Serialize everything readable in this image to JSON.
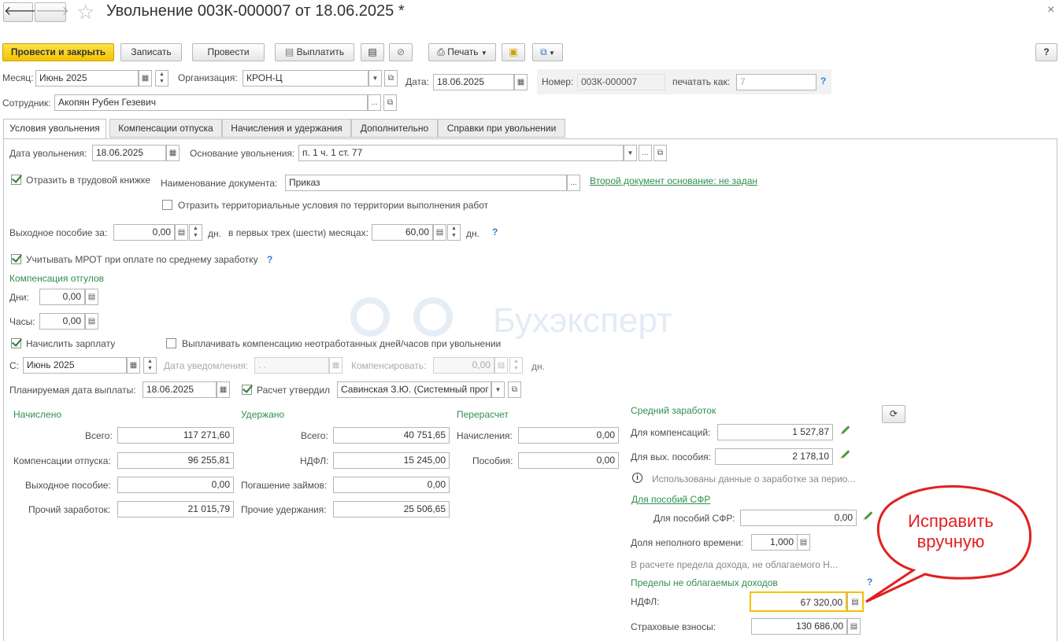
{
  "window": {
    "title": "Увольнение 003К-000007 от 18.06.2025 *",
    "close": "×"
  },
  "toolbar": {
    "post_close": "Провести и закрыть",
    "save": "Записать",
    "post": "Провести",
    "pay": "Выплатить",
    "print": "Печать",
    "help": "?"
  },
  "header": {
    "month_label": "Месяц:",
    "month_value": "Июнь 2025",
    "org_label": "Организация:",
    "org_value": "КРОН-Ц",
    "date_label": "Дата:",
    "date_value": "18.06.2025",
    "number_label": "Номер:",
    "number_value": "003К-000007",
    "print_as_label": "печатать как:",
    "print_as_value": "7",
    "employee_label": "Сотрудник:",
    "employee_value": "Акопян Рубен Гезевич"
  },
  "tabs": [
    "Условия увольнения",
    "Компенсации отпуска",
    "Начисления и удержания",
    "Дополнительно",
    "Справки при увольнении"
  ],
  "conditions": {
    "dismissal_date_label": "Дата увольнения:",
    "dismissal_date": "18.06.2025",
    "basis_label": "Основание увольнения:",
    "basis_value": "п. 1 ч. 1 ст. 77",
    "reflect_book": "Отразить в трудовой книжке",
    "doc_name_label": "Наименование документа:",
    "doc_name_value": "Приказ",
    "second_doc_link": "Второй документ основание: не задан",
    "territorial": "Отразить территориальные условия по территории выполнения работ",
    "severance_label": "Выходное пособие за:",
    "severance_days": "0,00",
    "days_unit": "дн.",
    "first_months_label": "в первых трех (шести) месяцах:",
    "first_months_days": "60,00",
    "mrot": "Учитывать МРОТ при оплате по среднему заработку",
    "vacation_comp_title": "Компенсация отгулов",
    "days_label": "Дни:",
    "days_value": "0,00",
    "hours_label": "Часы:",
    "hours_value": "0,00",
    "accrue_salary": "Начислить зарплату",
    "pay_unworked": "Выплачивать компенсацию неотработанных дней/часов при увольнении",
    "from_label": "С:",
    "from_value": "Июнь 2025",
    "notice_label": "Дата уведомления:",
    "notice_value": "  .  .",
    "compensate_label": "Компенсировать:",
    "compensate_value": "0,00",
    "planned_pay_label": "Планируемая дата выплаты:",
    "planned_pay_value": "18.06.2025",
    "approved_label": "Расчет утвердил",
    "approved_value": "Савинская З.Ю. (Системный прог"
  },
  "accrued": {
    "title": "Начислено",
    "total_label": "Всего:",
    "total": "117 271,60",
    "vacation_label": "Компенсации отпуска:",
    "vacation": "96 255,81",
    "severance_label": "Выходное пособие:",
    "severance": "0,00",
    "other_label": "Прочий заработок:",
    "other": "21 015,79"
  },
  "withheld": {
    "title": "Удержано",
    "total_label": "Всего:",
    "total": "40 751,65",
    "ndfl_label": "НДФЛ:",
    "ndfl": "15 245,00",
    "loans_label": "Погашение займов:",
    "loans": "0,00",
    "other_label": "Прочие удержания:",
    "other": "25 506,65"
  },
  "recalc": {
    "title": "Перерасчет",
    "accruals_label": "Начисления:",
    "accruals": "0,00",
    "benefits_label": "Пособия:",
    "benefits": "0,00"
  },
  "avg": {
    "title": "Средний заработок",
    "comp_label": "Для компенсаций:",
    "comp_value": "1 527,87",
    "sev_label": "Для вых. пособия:",
    "sev_value": "2 178,10",
    "info": "Использованы данные о заработке за перио...",
    "sfr_link": "Для пособий СФР",
    "sfr_label": "Для пособий СФР:",
    "sfr_value": "0,00",
    "part_label": "Доля неполного времени:",
    "part_value": "1,000",
    "limit_note": "В расчете предела дохода, не облагаемого Н...",
    "limits_title": "Пределы не облагаемых доходов",
    "ndfl_label": "НДФЛ:",
    "ndfl_value": "67 320,00",
    "ins_label": "Страховые взносы:",
    "ins_value": "130 686,00"
  },
  "watermark": "Бухэксперт",
  "callout": "Исправить вручную"
}
